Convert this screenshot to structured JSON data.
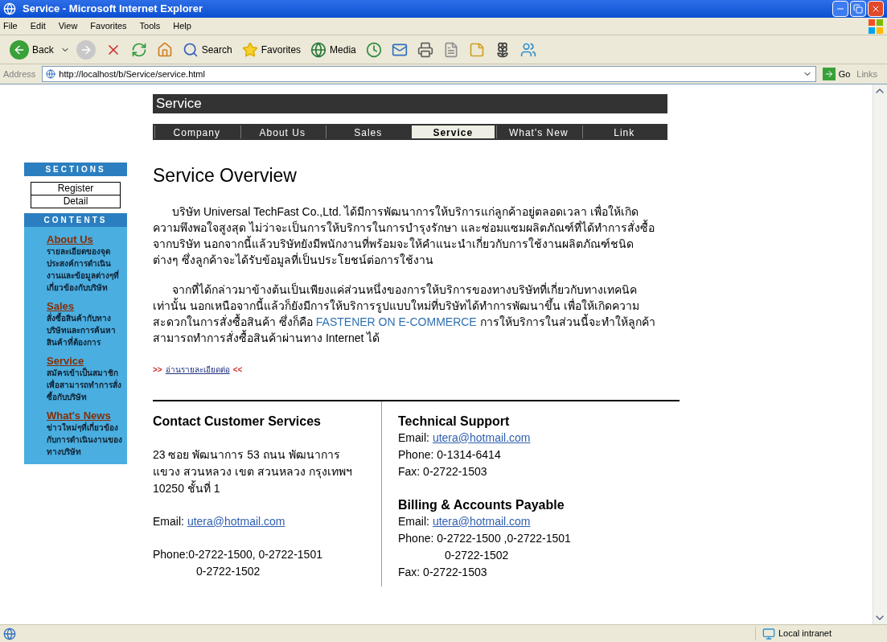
{
  "window": {
    "title": "Service - Microsoft Internet Explorer"
  },
  "menu": [
    "File",
    "Edit",
    "View",
    "Favorites",
    "Tools",
    "Help"
  ],
  "toolbar": {
    "back": "Back",
    "search": "Search",
    "favorites": "Favorites",
    "media": "Media"
  },
  "address_bar": {
    "label": "Address",
    "url": "http://localhost/b/Service/service.html",
    "go": "Go",
    "links": "Links"
  },
  "page": {
    "banner": "Service",
    "nav": [
      {
        "label": "Company",
        "selected": false
      },
      {
        "label": "About Us",
        "selected": false
      },
      {
        "label": "Sales",
        "selected": false
      },
      {
        "label": "Service",
        "selected": true
      },
      {
        "label": "What's New",
        "selected": false
      },
      {
        "label": "Link",
        "selected": false
      }
    ],
    "sidebar": {
      "sections_title": "SECTIONS",
      "sections": [
        "Register",
        "Detail"
      ],
      "contents_title": "CONTENTS",
      "contents": [
        {
          "title": "About Us",
          "description": "รายละเอียดของจุดประสงค์การดำเนินงานและข้อมูลต่างๆที่เกี่ยวข้องกับบริษัท"
        },
        {
          "title": "Sales",
          "description": "สั่งซื้อสินค้ากับทางบริษัทและการค้นหาสินค้าที่ต้องการ"
        },
        {
          "title": "Service",
          "description": "สมัครเข้าเป็นสมาชิกเพื่อสามารถทำการสั่งซื้อกับบริษัท"
        },
        {
          "title": "What's News",
          "description": "ข่าวใหม่ๆที่เกี่ยวข้องกับการดำเนินงานของทางบริษัท"
        }
      ]
    },
    "heading": "Service Overview",
    "paragraphs": [
      {
        "before": "บริษัท Universal TechFast Co.,Ltd. ได้มีการพัฒนาการให้บริการแก่ลูกค้าอยู่ตลอดเวลา เพื่อให้เกิดความพึงพอใจสูงสุด ไม่ว่าจะเป็นการให้บริการในการบำรุงรักษา และซ่อมแซมผลิตภัณฑ์ที่ได้ทำการสั่งซื้อจากบริษัท นอกจากนี้แล้วบริษัทยังมีพนักงานที่พร้อมจะให้คำแนะนำเกี่ยวกับการใช้งานผลิตภัณฑ์ชนิดต่างๆ ซึ่งลูกค้าจะได้รับข้อมูลที่เป็นประโยชน์ต่อการใช้งาน"
      },
      {
        "before": "จากที่ได้กล่าวมาข้างต้นเป็นเพียงแค่ส่วนหนึ่งของการให้บริการของทางบริษัทที่เกี่ยวกับทางเทคนิคเท่านั้น นอกเหนือจากนี้แล้วก็ยังมีการให้บริการรูปแบบใหม่ที่บริษัทได้ทำการพัฒนาขึ้น เพื่อให้เกิดความสะดวกในการสั่งซื้อสินค้า ซึ่งก็คือ ",
        "highlight": "FASTENER ON E-COMMERCE",
        "after": " การให้บริการในส่วนนี้จะทำให้ลูกค้าสามารถทำการสั่งซื้อสินค้าผ่านทาง Internet ได้"
      }
    ],
    "read_more": {
      "left_mark": ">>",
      "label": "อ่านรายละเอียดต่อ",
      "right_mark": "<<"
    },
    "contact": {
      "title": "Contact Customer Services",
      "address": [
        "23 ซอย พัฒนาการ 53 ถนน พัฒนาการ",
        "แขวง สวนหลวง เขต สวนหลวง กรุงเทพฯ",
        "10250  ชั้นที่ 1"
      ],
      "email_label": "Email:",
      "email": "utera@hotmail.com",
      "phone": [
        "Phone:0-2722-1500, 0-2722-1501",
        "0-2722-1502"
      ]
    },
    "support": [
      {
        "title": "Technical Support",
        "email_label": "Email:",
        "email": "utera@hotmail.com",
        "lines": [
          {
            "text": "Phone: 0-1314-6414",
            "indent": false
          },
          {
            "text": "Fax: 0-2722-1503",
            "indent": false
          }
        ]
      },
      {
        "title": "Billing & Accounts Payable",
        "email_label": "Email:",
        "email": "utera@hotmail.com",
        "lines": [
          {
            "text": "Phone: 0-2722-1500 ,0-2722-1501",
            "indent": false
          },
          {
            "text": "0-2722-1502",
            "indent": true
          },
          {
            "text": "Fax: 0-2722-1503",
            "indent": false
          }
        ]
      }
    ]
  },
  "status_bar": {
    "zone": "Local intranet"
  }
}
